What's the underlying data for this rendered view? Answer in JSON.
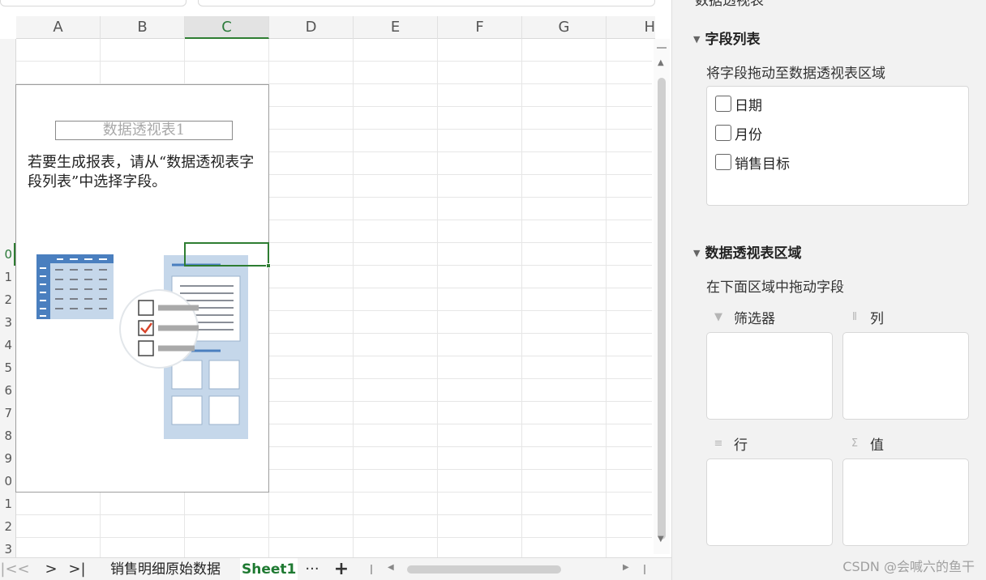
{
  "spreadsheet": {
    "columns": [
      {
        "label": "A"
      },
      {
        "label": "B"
      },
      {
        "label": "C"
      },
      {
        "label": "D"
      },
      {
        "label": "E"
      },
      {
        "label": "F"
      },
      {
        "label": "G"
      },
      {
        "label": "H"
      }
    ],
    "selected_column": "C",
    "rows": [
      "0",
      "1",
      "2",
      "3",
      "4",
      "5",
      "6",
      "7",
      "8",
      "9",
      "0",
      "1",
      "2",
      "3"
    ],
    "selected_row": "0",
    "pivot_placeholder": {
      "name": "数据透视表1",
      "hint": "若要生成报表，请从“数据透视表字段列表”中选择字段。"
    }
  },
  "tab_bar": {
    "nav": {
      "first": "|<",
      "prev": "<",
      "next": ">",
      "last": ">|"
    },
    "tabs": [
      {
        "label": "销售明细原始数据",
        "active": false
      },
      {
        "label": "Sheet1",
        "active": true
      }
    ],
    "more_label": "···",
    "add_label": "+"
  },
  "panel": {
    "title": "数据透视表",
    "field_section": {
      "title": "字段列表",
      "instruction": "将字段拖动至数据透视表区域",
      "fields": [
        {
          "label": "日期",
          "checked": false
        },
        {
          "label": "月份",
          "checked": false
        },
        {
          "label": "销售目标",
          "checked": false
        }
      ]
    },
    "areas_section": {
      "title": "数据透视表区域",
      "instruction": "在下面区域中拖动字段",
      "areas": [
        {
          "label": "筛选器",
          "icon": "filter-icon"
        },
        {
          "label": "列",
          "icon": "columns-icon"
        },
        {
          "label": "行",
          "icon": "rows-icon"
        },
        {
          "label": "值",
          "icon": "sigma-icon"
        }
      ]
    }
  },
  "watermark": "CSDN @会喊六的鱼干",
  "colors": {
    "accent_green": "#2e7d32",
    "illustration_blue": "#4a7fbf",
    "illustration_light_blue": "#c5d7ea",
    "check_red": "#d9452b"
  }
}
